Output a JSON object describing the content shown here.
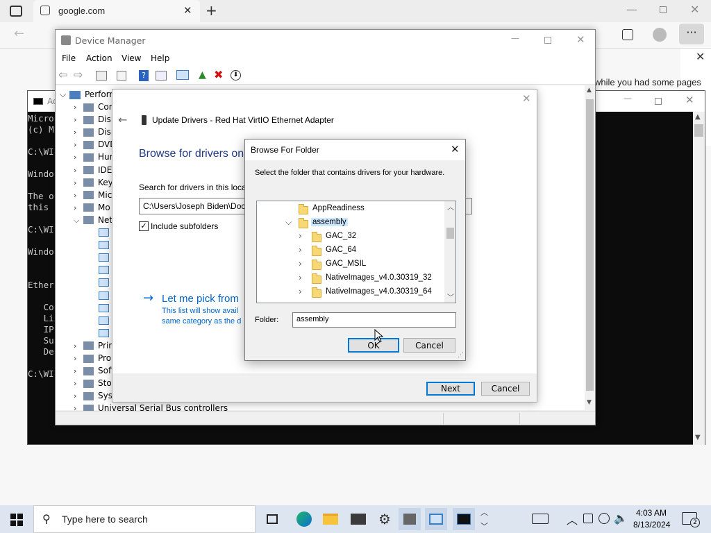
{
  "browser": {
    "tab_title": "google.com",
    "info_text": "while you had some pages"
  },
  "cmd": {
    "lines": [
      "Micro",
      "(c) M",
      "",
      "C:\\WI",
      "",
      "Windo",
      "",
      "The o",
      "this ",
      "",
      "C:\\WI",
      "",
      "Windo",
      "",
      "",
      "Ether",
      "",
      "   Co",
      "   Li",
      "   IP",
      "   Su",
      "   De",
      "",
      "C:\\WI"
    ],
    "title": "Ad"
  },
  "device_manager": {
    "title": "Device Manager",
    "menu": [
      "File",
      "Action",
      "View",
      "Help"
    ],
    "root": "Perform",
    "items": [
      "Com",
      "Disk",
      "Disp",
      "DVD",
      "Hum",
      "IDE",
      "Key",
      "Mic",
      "Mo",
      "Net",
      "Prin",
      "Pro",
      "Soft",
      "Stor",
      "Syst",
      "Universal Serial Bus controllers"
    ]
  },
  "wizard": {
    "title": "Update Drivers - Red Hat VirtIO Ethernet Adapter",
    "heading": "Browse for drivers on",
    "search_label": "Search for drivers in this loca",
    "path_value": "C:\\Users\\Joseph Biden\\Docu",
    "include_subfolders": "Include subfolders",
    "pick_link": "Let me pick from",
    "pick_desc_1": "This list will show avail",
    "pick_desc_2": "same category as the d",
    "next_label": "Next",
    "cancel_label": "Cancel"
  },
  "browse_dialog": {
    "title": "Browse For Folder",
    "instruction": "Select the folder that contains drivers for your hardware.",
    "folders": [
      {
        "name": "AppReadiness",
        "indent": 0,
        "expander": ""
      },
      {
        "name": "assembly",
        "indent": 0,
        "expander": "expanded"
      },
      {
        "name": "GAC_32",
        "indent": 1,
        "expander": "collapsed"
      },
      {
        "name": "GAC_64",
        "indent": 1,
        "expander": "collapsed"
      },
      {
        "name": "GAC_MSIL",
        "indent": 1,
        "expander": "collapsed"
      },
      {
        "name": "NativeImages_v4.0.30319_32",
        "indent": 1,
        "expander": "collapsed"
      },
      {
        "name": "NativeImages_v4.0.30319_64",
        "indent": 1,
        "expander": "collapsed"
      }
    ],
    "selected_folder": "assembly",
    "folder_label": "Folder:",
    "folder_value": "assembly",
    "ok_label": "OK",
    "cancel_label": "Cancel"
  },
  "taskbar": {
    "search_placeholder": "Type here to search",
    "time": "4:03 AM",
    "date": "8/13/2024",
    "notification_count": "2"
  },
  "colors": {
    "accent": "#0078d7",
    "link": "#0066cc",
    "heading": "#1e3a8a",
    "selected": "#cce8ff"
  }
}
